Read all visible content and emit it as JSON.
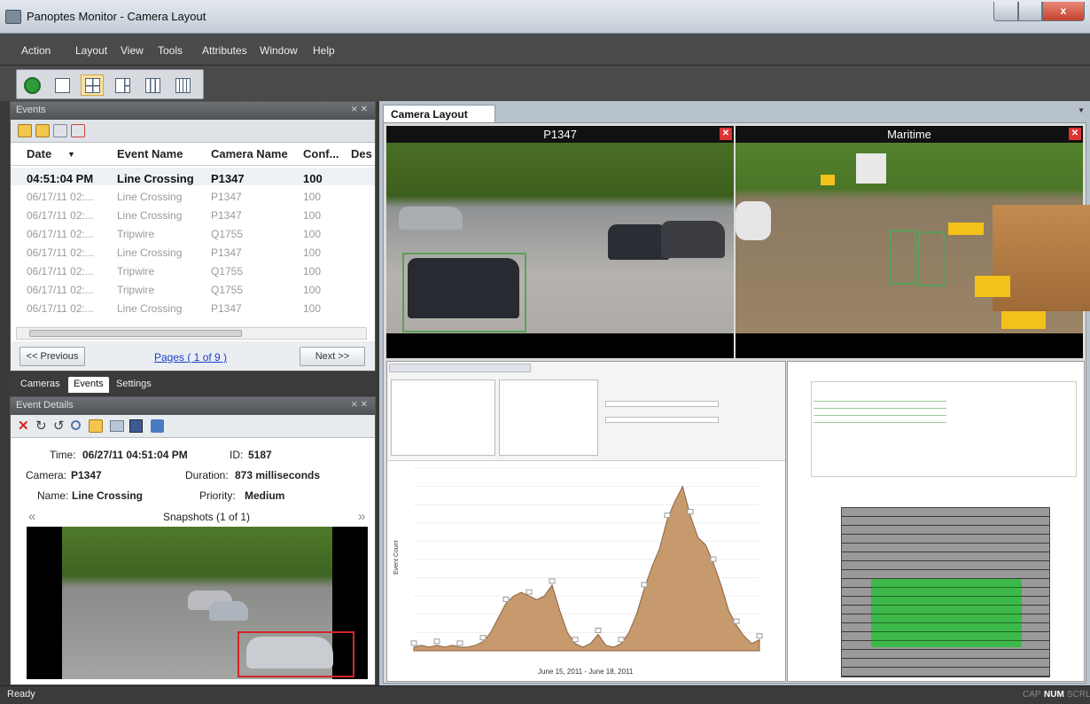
{
  "window": {
    "title": "Panoptes Monitor - Camera Layout",
    "close_glyph": "x"
  },
  "menu": [
    "Action",
    "Layout",
    "View",
    "Tools",
    "Attributes",
    "Window",
    "Help"
  ],
  "events_panel": {
    "title": "Events",
    "pin": "⨯ ✕",
    "columns": [
      "Date",
      "Event Name",
      "Camera Name",
      "Conf...",
      "Des"
    ],
    "rows": [
      [
        "04:51:04 PM",
        "Line Crossing",
        "P1347",
        "100"
      ],
      [
        "06/17/11 02:...",
        "Line Crossing",
        "P1347",
        "100"
      ],
      [
        "06/17/11 02:...",
        "Line Crossing",
        "P1347",
        "100"
      ],
      [
        "06/17/11 02:...",
        "Tripwire",
        "Q1755",
        "100"
      ],
      [
        "06/17/11 02:...",
        "Line Crossing",
        "P1347",
        "100"
      ],
      [
        "06/17/11 02:...",
        "Tripwire",
        "Q1755",
        "100"
      ],
      [
        "06/17/11 02:...",
        "Tripwire",
        "Q1755",
        "100"
      ],
      [
        "06/17/11 02:...",
        "Line Crossing",
        "P1347",
        "100"
      ]
    ],
    "prev": "<< Previous",
    "pages": "Pages ( 1 of 9 )",
    "next": "Next >>"
  },
  "bottom_tabs": [
    "Cameras",
    "Events",
    "Settings"
  ],
  "event_details": {
    "title": "Event Details",
    "time_label": "Time:",
    "time_value": "06/27/11 04:51:04 PM",
    "id_label": "ID:",
    "id_value": "5187",
    "camera_label": "Camera:",
    "camera_value": "P1347",
    "duration_label": "Duration:",
    "duration_value": "873 milliseconds",
    "name_label": "Name:",
    "name_value": "Line Crossing",
    "priority_label": "Priority:",
    "priority_value": "Medium",
    "snapshots": "Snapshots (1 of 1)",
    "prev_arrow": "«",
    "next_arrow": "»"
  },
  "camera_layout": {
    "tab": "Camera Layout",
    "views": [
      {
        "name": "P1347"
      },
      {
        "name": "Maritime"
      }
    ]
  },
  "chart_data": {
    "type": "area",
    "title": "",
    "xlabel": "June 15, 2011 - June 18, 2011",
    "ylabel": "Event Count",
    "ylim": [
      0,
      100
    ],
    "values": [
      2,
      3,
      2,
      3,
      2,
      3,
      2,
      2,
      3,
      5,
      10,
      18,
      26,
      30,
      32,
      30,
      28,
      30,
      36,
      22,
      10,
      4,
      2,
      4,
      9,
      3,
      2,
      4,
      10,
      20,
      34,
      46,
      56,
      72,
      82,
      90,
      74,
      62,
      58,
      48,
      36,
      22,
      14,
      8,
      4,
      6
    ],
    "color": "#c69a6d"
  },
  "status": {
    "text": "Ready",
    "keys": [
      "CAP",
      "NUM",
      "SCRL"
    ]
  }
}
